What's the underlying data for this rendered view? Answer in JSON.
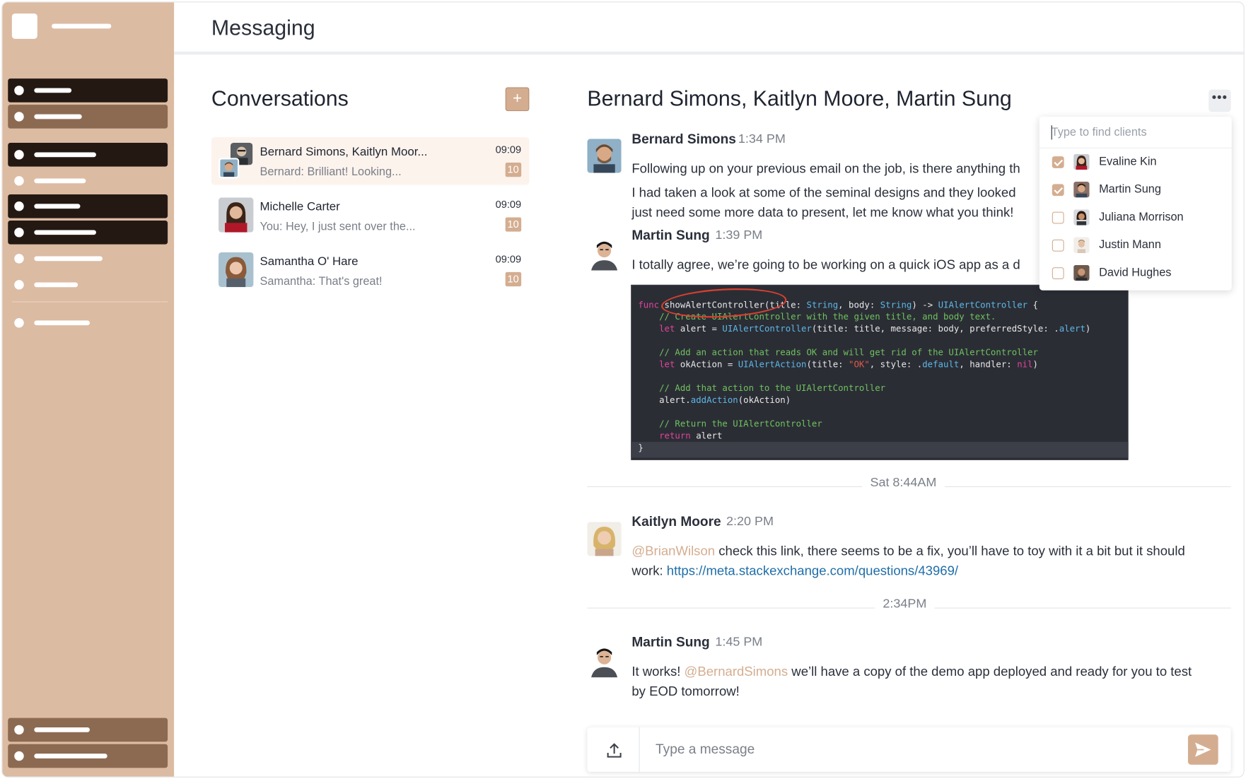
{
  "header": {
    "title": "Messaging"
  },
  "conversations": {
    "title": "Conversations",
    "new_button_label": "+",
    "items": [
      {
        "name": "Bernard Simons, Kaitlyn Moor...",
        "preview": "Bernard: Brilliant! Looking...",
        "time": "09:09",
        "unread": "10",
        "active": true
      },
      {
        "name": "Michelle Carter",
        "preview": "You: Hey, I just sent over the...",
        "time": "09:09",
        "unread": "10",
        "active": false
      },
      {
        "name": "Samantha O' Hare",
        "preview": "Samantha: That's great!",
        "time": "09:09",
        "unread": "10",
        "active": false
      }
    ]
  },
  "chat": {
    "title": "Bernard Simons, Kaitlyn Moore, Martin Sung",
    "more_label": "•••",
    "messages": [
      {
        "author": "Bernard Simons",
        "time": "1:34 PM",
        "lines": [
          "Following up on your previous email on the job, is there anything th",
          "I had taken a look at some of the seminal designs and they looked",
          "just need some more data to present, let me know what you think!"
        ]
      },
      {
        "author": "Martin Sung",
        "time": "1:39 PM",
        "lines": [
          "I totally agree, we’re going to be working on a quick iOS app as a d"
        ]
      },
      {
        "author": "Kaitlyn Moore",
        "time": "2:20 PM",
        "mention": "@BrianWilson",
        "text_after_mention": " check this link, there seems to be a fix, you’ll have to toy with it a bit but it should",
        "line2_prefix": "work: ",
        "link": "https://meta.stackexchange.com/questions/43969/"
      },
      {
        "author": "Martin Sung",
        "time": "1:45 PM",
        "prefix": "It works! ",
        "mention": "@BernardSimons",
        "text_after_mention": " we’ll have a copy of the demo app deployed and ready for you to test",
        "line2": "by EOD tomorrow!"
      }
    ],
    "separators": [
      "Sat 8:44AM",
      "2:34PM"
    ],
    "code": {
      "line1_kw": "func ",
      "line1_fn": "showAlertController",
      "line1_rest_a": "(title: ",
      "line1_type1": "String",
      "line1_rest_b": ", body: ",
      "line1_type2": "String",
      "line1_rest_c": ") -> ",
      "line1_type3": "UIAlertController",
      "line1_rest_d": " {",
      "line2": "    // Create UIAlertController with the given title, and body text.",
      "line3_kw": "    let",
      "line3_a": " alert = ",
      "line3_type": "UIAlertController",
      "line3_b": "(title: title, message: body, preferredStyle: .",
      "line3_t": "alert",
      "line3_c": ")",
      "line4": "    // Add an action that reads OK and will get rid of the UIAlertController",
      "line5_kw": "    let",
      "line5_a": " okAction = ",
      "line5_type": "UIAlertAction",
      "line5_b": "(title: ",
      "line5_str": "\"OK\"",
      "line5_c": ", style: .",
      "line5_t": "default",
      "line5_d": ", handler: ",
      "line5_nil": "nil",
      "line5_e": ")",
      "line6": "    // Add that action to the UIAlertController",
      "line7_a": "    alert.",
      "line7_fn": "addAction",
      "line7_b": "(okAction)",
      "line8": "    // Return the UIAlertController",
      "line9_kw": "    return",
      "line9_a": " alert",
      "line10": "}"
    }
  },
  "composer": {
    "placeholder": "Type a message"
  },
  "client_picker": {
    "placeholder": "Type to find clients",
    "items": [
      {
        "name": "Evaline Kin",
        "checked": true
      },
      {
        "name": "Martin Sung",
        "checked": true
      },
      {
        "name": "Juliana Morrison",
        "checked": false
      },
      {
        "name": "Justin Mann",
        "checked": false
      },
      {
        "name": "David Hughes",
        "checked": false
      }
    ]
  },
  "colors": {
    "accent": "#d4ad90",
    "sidebar": "#dcbba3",
    "nav_dark": "#241912",
    "nav_mid": "#8c6a52",
    "link": "#1f6ea8"
  }
}
